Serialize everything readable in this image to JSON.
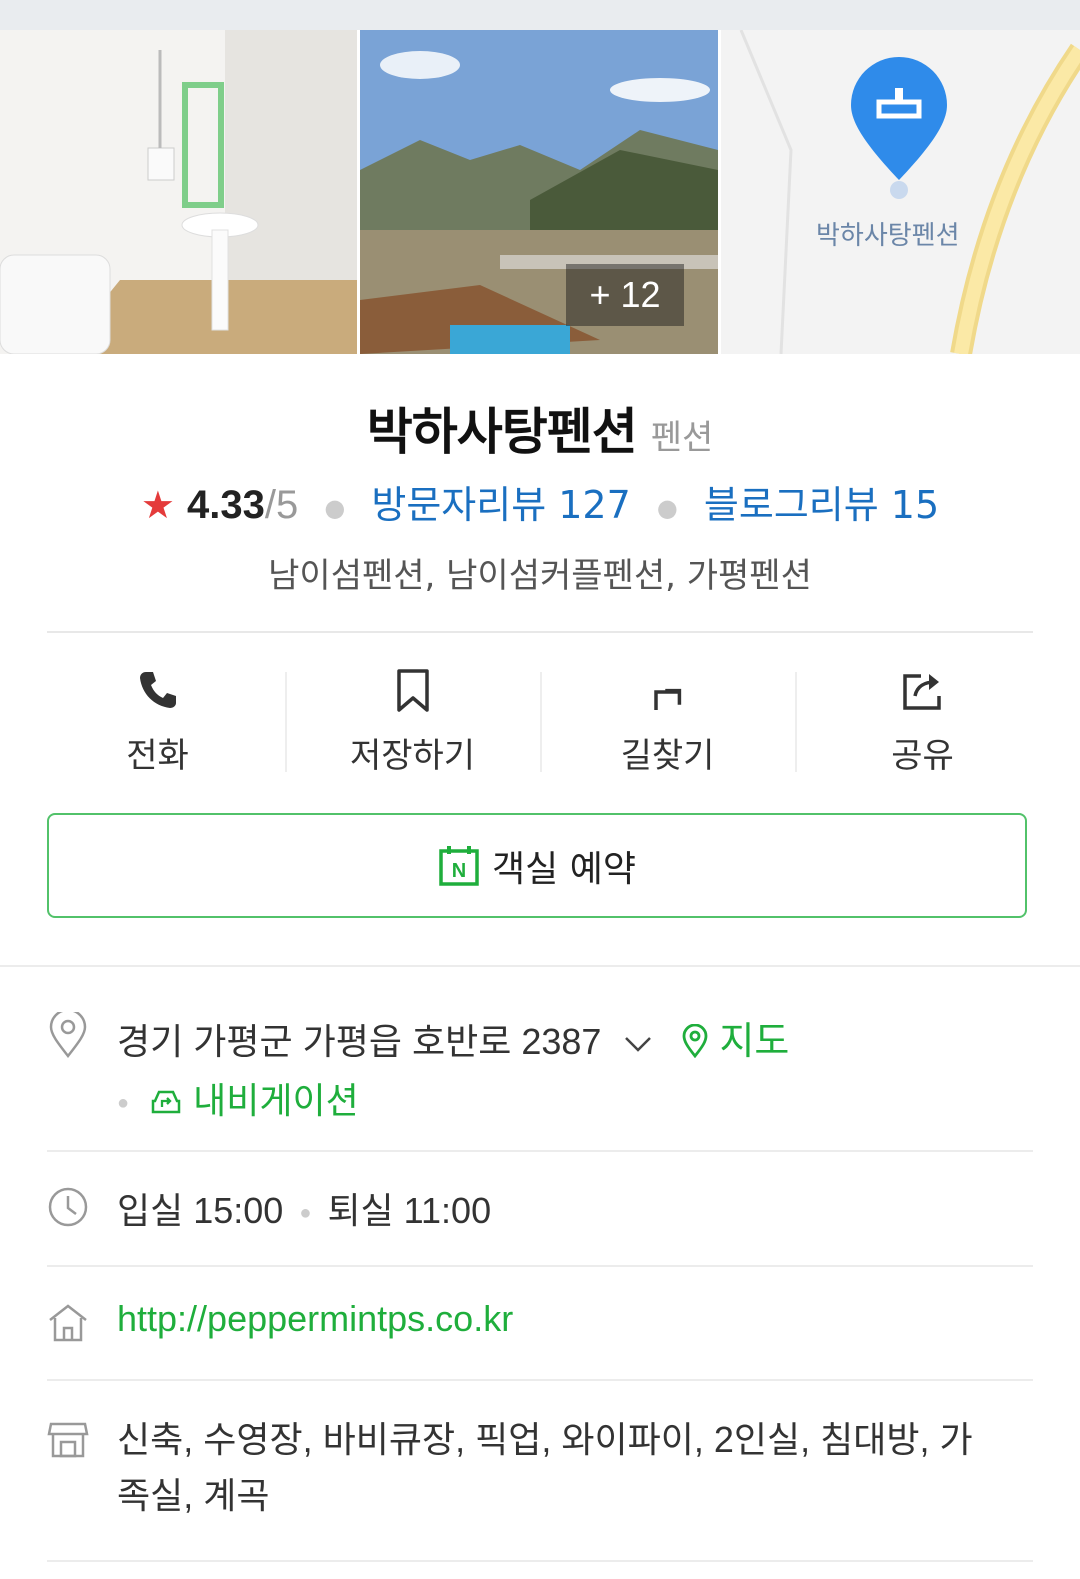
{
  "colors": {
    "accent_green": "#1fae3c",
    "link_blue": "#1a6fc0",
    "star_red": "#e43b3b"
  },
  "gallery": {
    "more_count": "+ 12",
    "map_pin_label": "박하사탕펜션"
  },
  "place": {
    "name": "박하사탕펜션",
    "category": "펜션",
    "rating": "4.33",
    "rating_scale": "/5",
    "visitor_reviews": "방문자리뷰 127",
    "blog_reviews": "블로그리뷰 15",
    "keywords": "남이섬펜션, 남이섬커플펜션, 가평펜션"
  },
  "actions": {
    "call": "전화",
    "save": "저장하기",
    "directions": "길찾기",
    "share": "공유"
  },
  "reserve": {
    "label": "객실 예약",
    "icon": "naver-booking-icon"
  },
  "info": {
    "address": "경기 가평군 가평읍 호반로 2387",
    "map_link": "지도",
    "navigation_link": "내비게이션",
    "checkin": "입실 15:00",
    "checkout": "퇴실 11:00",
    "website": "http://peppermintps.co.kr",
    "amenities_line1": "신축, 수영장, 바비큐장, 픽업, 와이파이, 2인실, 침대방, 가",
    "amenities_line2": "족실, 계곡"
  }
}
